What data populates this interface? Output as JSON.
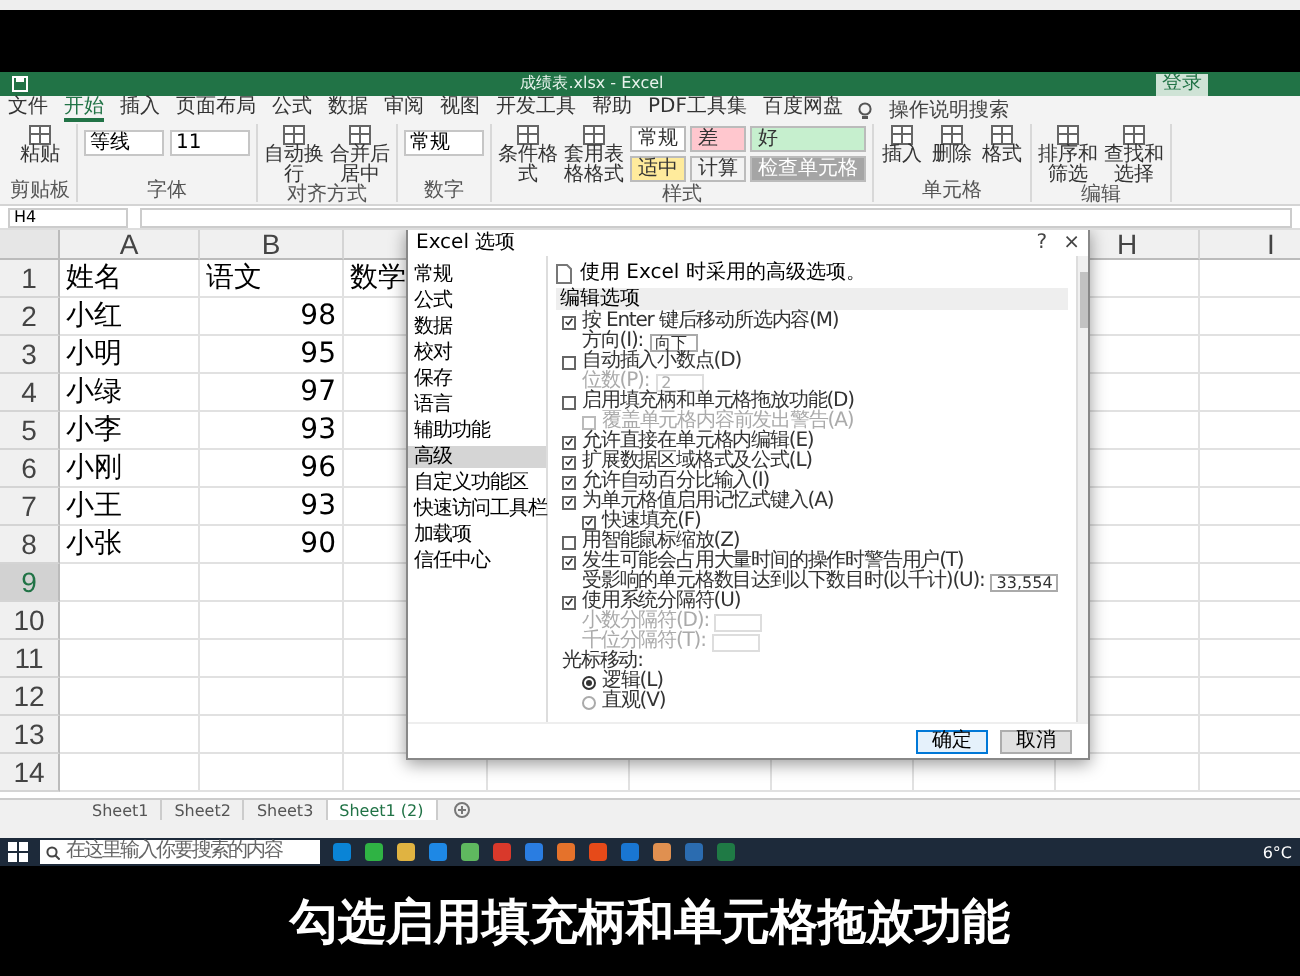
{
  "window": {
    "title": "成绩表.xlsx - Excel",
    "sign_in": "登录"
  },
  "ribbon_tabs": [
    {
      "label": "文件",
      "selected": false
    },
    {
      "label": "开始",
      "selected": true
    },
    {
      "label": "插入",
      "selected": false
    },
    {
      "label": "页面布局",
      "selected": false
    },
    {
      "label": "公式",
      "selected": false
    },
    {
      "label": "数据",
      "selected": false
    },
    {
      "label": "审阅",
      "selected": false
    },
    {
      "label": "视图",
      "selected": false
    },
    {
      "label": "开发工具",
      "selected": false
    },
    {
      "label": "帮助",
      "selected": false
    },
    {
      "label": "PDF工具集",
      "selected": false
    },
    {
      "label": "百度网盘",
      "selected": false
    }
  ],
  "tell_me": "操作说明搜索",
  "ribbon_groups": [
    {
      "label": "剪贴板",
      "items": [
        {
          "kind": "big",
          "text": "粘贴"
        }
      ]
    },
    {
      "label": "字体",
      "items": [
        {
          "kind": "field",
          "text": "等线"
        },
        {
          "kind": "field",
          "text": "11"
        }
      ]
    },
    {
      "label": "对齐方式",
      "items": [
        {
          "kind": "big",
          "text": "自动换行"
        },
        {
          "kind": "big",
          "text": "合并后居中"
        }
      ]
    },
    {
      "label": "数字",
      "items": [
        {
          "kind": "field",
          "text": "常规"
        }
      ]
    },
    {
      "label": "样式",
      "items": [
        {
          "kind": "big",
          "text": "条件格式"
        },
        {
          "kind": "big",
          "text": "套用表格格式"
        },
        {
          "kind": "style",
          "text": "常规",
          "color": "#ffffff"
        },
        {
          "kind": "style",
          "text": "差",
          "color": "#ffc7ce"
        },
        {
          "kind": "style",
          "text": "好",
          "color": "#c6efce"
        },
        {
          "kind": "style",
          "text": "适中",
          "color": "#ffeb9c"
        },
        {
          "kind": "style",
          "text": "计算",
          "color": "#f2f2f2"
        },
        {
          "kind": "style",
          "text": "检查单元格",
          "color": "#a5a5a5"
        }
      ]
    },
    {
      "label": "单元格",
      "items": [
        {
          "kind": "big",
          "text": "插入"
        },
        {
          "kind": "big",
          "text": "删除"
        },
        {
          "kind": "big",
          "text": "格式"
        }
      ]
    },
    {
      "label": "编辑",
      "items": [
        {
          "kind": "big",
          "text": "排序和筛选"
        },
        {
          "kind": "big",
          "text": "查找和选择"
        }
      ]
    }
  ],
  "name_box": "H4",
  "columns": [
    "A",
    "B",
    null,
    null,
    null,
    null,
    null,
    "H",
    "I"
  ],
  "rows": [
    {
      "header": "1",
      "cells": [
        "姓名",
        "语文",
        "数学"
      ]
    },
    {
      "header": "2",
      "cells": [
        "小红",
        "98"
      ]
    },
    {
      "header": "3",
      "cells": [
        "小明",
        "95"
      ]
    },
    {
      "header": "4",
      "cells": [
        "小绿",
        "97"
      ]
    },
    {
      "header": "5",
      "cells": [
        "小李",
        "93"
      ]
    },
    {
      "header": "6",
      "cells": [
        "小刚",
        "96"
      ]
    },
    {
      "header": "7",
      "cells": [
        "小王",
        "93"
      ]
    },
    {
      "header": "8",
      "cells": [
        "小张",
        "90"
      ]
    },
    {
      "header": "9",
      "selected": true,
      "cells": []
    },
    {
      "header": "10",
      "cells": []
    },
    {
      "header": "11",
      "cells": []
    },
    {
      "header": "12",
      "cells": []
    },
    {
      "header": "13",
      "cells": []
    },
    {
      "header": "14",
      "cells": []
    }
  ],
  "dialog": {
    "title": "Excel 选项",
    "help": "?",
    "close": "×",
    "sidebar": [
      {
        "label": "常规",
        "selected": false
      },
      {
        "label": "公式",
        "selected": false
      },
      {
        "label": "数据",
        "selected": false
      },
      {
        "label": "校对",
        "selected": false
      },
      {
        "label": "保存",
        "selected": false
      },
      {
        "label": "语言",
        "selected": false
      },
      {
        "label": "辅助功能",
        "selected": false
      },
      {
        "label": "高级",
        "selected": true
      },
      {
        "label": "自定义功能区",
        "selected": false
      },
      {
        "label": "快速访问工具栏",
        "selected": false
      },
      {
        "label": "加载项",
        "selected": false
      },
      {
        "label": "信任中心",
        "selected": false
      }
    ],
    "heading": "使用 Excel 时采用的高级选项。",
    "section": "编辑选项",
    "options": [
      {
        "kind": "checkbox",
        "label": "按 Enter 键后移动所选内容(M)",
        "checked": true,
        "children": [
          {
            "kind": "field",
            "label": "方向(I):",
            "value": "向下",
            "disabled": false
          }
        ]
      },
      {
        "kind": "checkbox",
        "label": "自动插入小数点(D)",
        "checked": false,
        "children": [
          {
            "kind": "field",
            "label": "位数(P):",
            "value": "2",
            "disabled": true
          }
        ]
      },
      {
        "kind": "checkbox",
        "label": "启用填充柄和单元格拖放功能(D)",
        "checked": false,
        "children": [
          {
            "kind": "checkbox",
            "label": "覆盖单元格内容前发出警告(A)",
            "checked": false,
            "disabled": true
          }
        ]
      },
      {
        "kind": "checkbox",
        "label": "允许直接在单元格内编辑(E)",
        "checked": true
      },
      {
        "kind": "checkbox",
        "label": "扩展数据区域格式及公式(L)",
        "checked": true
      },
      {
        "kind": "checkbox",
        "label": "允许自动百分比输入(I)",
        "checked": true
      },
      {
        "kind": "checkbox",
        "label": "为单元格值启用记忆式键入(A)",
        "checked": true,
        "children": [
          {
            "kind": "checkbox",
            "label": "快速填充(F)",
            "checked": true,
            "disabled": false
          }
        ]
      },
      {
        "kind": "checkbox",
        "label": "用智能鼠标缩放(Z)",
        "checked": false
      },
      {
        "kind": "checkbox",
        "label": "发生可能会占用大量时间的操作时警告用户(T)",
        "checked": true,
        "children": [
          {
            "kind": "field",
            "label": "受影响的单元格数目达到以下数目时(以千计)(U):",
            "value": "33,554",
            "disabled": false
          }
        ]
      },
      {
        "kind": "checkbox",
        "label": "使用系统分隔符(U)",
        "checked": true,
        "children": [
          {
            "kind": "field",
            "label": "小数分隔符(D):",
            "disabled": true
          },
          {
            "kind": "field",
            "label": "千位分隔符(T):",
            "disabled": true
          }
        ]
      },
      {
        "kind": "label",
        "label": "光标移动:",
        "children": [
          {
            "kind": "radio",
            "label": "逻辑(L)",
            "selected": true
          },
          {
            "kind": "radio",
            "label": "直观(V)",
            "selected": false
          }
        ]
      }
    ],
    "buttons": [
      {
        "label": "确定",
        "primary": true
      },
      {
        "label": "取消",
        "primary": false
      }
    ]
  },
  "sheet_tabs": [
    {
      "label": "Sheet1",
      "selected": false
    },
    {
      "label": "Sheet2",
      "selected": false
    },
    {
      "label": "Sheet3",
      "selected": false
    },
    {
      "label": "Sheet1 (2)",
      "selected": true
    }
  ],
  "taskbar": {
    "search_placeholder": "在这里输入你要搜索的内容",
    "weather": "6°C"
  },
  "subtitle": "勾选启用填充柄和单元格拖放功能"
}
